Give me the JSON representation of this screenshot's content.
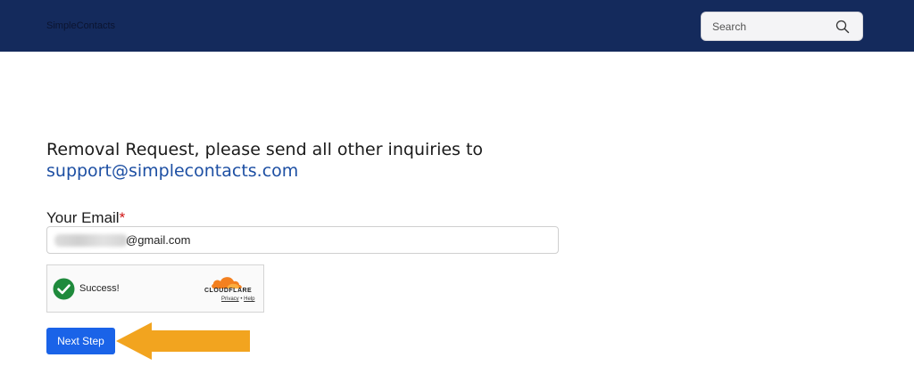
{
  "header": {
    "brand": "SimpleContacts",
    "search": {
      "placeholder": "Search",
      "icon": "search-icon"
    },
    "background": "#142a5c"
  },
  "form": {
    "heading_line1": "Removal Request, please send all other inquiries to",
    "heading_link": "support@simplecontacts.com",
    "email_label": "Your Email",
    "required_marker": "*",
    "email_value_visible": "@gmail.com",
    "captcha": {
      "status": "Success!",
      "provider": "CLOUDFLARE",
      "privacy_link": "Privacy",
      "separator": "•",
      "help_link": "Help"
    },
    "next_button": "Next Step"
  },
  "colors": {
    "link": "#1d4fa3",
    "button": "#1a63e8",
    "required": "#d01515",
    "arrow": "#f2a41f",
    "success": "#1f8a3c",
    "cloudflare": "#f38020"
  }
}
